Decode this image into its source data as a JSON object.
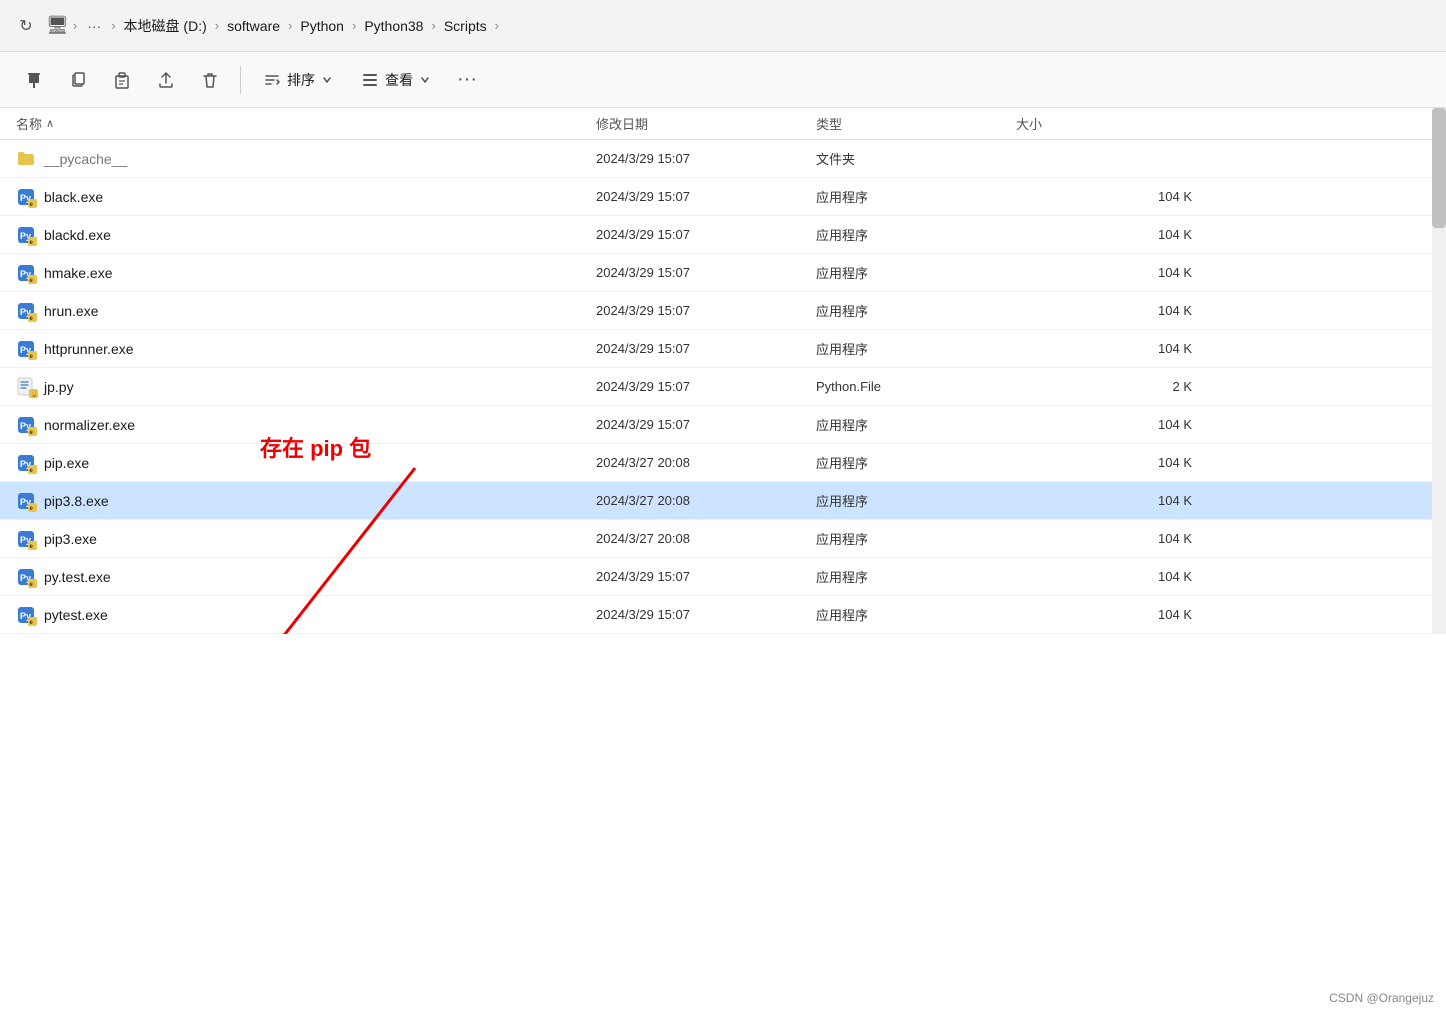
{
  "titlebar": {
    "refresh_icon": "↻",
    "computer_icon": "🖥",
    "breadcrumbs": [
      {
        "label": "本地磁盘 (D:)",
        "id": "local-disk"
      },
      {
        "label": "software",
        "id": "software"
      },
      {
        "label": "Python",
        "id": "python"
      },
      {
        "label": "Python38",
        "id": "python38"
      },
      {
        "label": "Scripts",
        "id": "scripts"
      }
    ],
    "more_label": "···",
    "end_chevron": "›"
  },
  "toolbar": {
    "pin_icon": "📌",
    "copy_icon": "📋",
    "paste_icon": "📄",
    "share_icon": "↑",
    "delete_icon": "🗑",
    "sort_label": "排序",
    "sort_icon": "⇅",
    "view_label": "查看",
    "view_icon": "≡",
    "more_label": "···"
  },
  "columns": {
    "name": "名称",
    "modified": "修改日期",
    "type": "类型",
    "size": "大小",
    "sort_indicator": "∧"
  },
  "annotation": {
    "text": "存在 pip 包",
    "color": "#e00"
  },
  "files": [
    {
      "name": "__pycache__",
      "modified": "2024/3/29 15:07",
      "type": "文件夹",
      "size": "",
      "icon_type": "folder",
      "partial": true
    },
    {
      "name": "black.exe",
      "modified": "2024/3/29 15:07",
      "type": "应用程序",
      "size": "104",
      "icon_type": "exe"
    },
    {
      "name": "blackd.exe",
      "modified": "2024/3/29 15:07",
      "type": "应用程序",
      "size": "104",
      "icon_type": "exe"
    },
    {
      "name": "hmake.exe",
      "modified": "2024/3/29 15:07",
      "type": "应用程序",
      "size": "104",
      "icon_type": "exe"
    },
    {
      "name": "hrun.exe",
      "modified": "2024/3/29 15:07",
      "type": "应用程序",
      "size": "104",
      "icon_type": "exe"
    },
    {
      "name": "httprunner.exe",
      "modified": "2024/3/29 15:07",
      "type": "应用程序",
      "size": "104",
      "icon_type": "exe"
    },
    {
      "name": "jp.py",
      "modified": "2024/3/29 15:07",
      "type": "Python.File",
      "size": "2",
      "icon_type": "py"
    },
    {
      "name": "normalizer.exe",
      "modified": "2024/3/29 15:07",
      "type": "应用程序",
      "size": "104",
      "icon_type": "exe"
    },
    {
      "name": "pip.exe",
      "modified": "2024/3/27 20:08",
      "type": "应用程序",
      "size": "104",
      "icon_type": "exe"
    },
    {
      "name": "pip3.8.exe",
      "modified": "2024/3/27 20:08",
      "type": "应用程序",
      "size": "104",
      "icon_type": "exe",
      "highlighted": true
    },
    {
      "name": "pip3.exe",
      "modified": "2024/3/27 20:08",
      "type": "应用程序",
      "size": "104",
      "icon_type": "exe"
    },
    {
      "name": "py.test.exe",
      "modified": "2024/3/29 15:07",
      "type": "应用程序",
      "size": "104",
      "icon_type": "exe"
    },
    {
      "name": "pytest.exe",
      "modified": "2024/3/29 15:07",
      "type": "应用程序",
      "size": "104",
      "icon_type": "exe"
    }
  ],
  "watermark": "CSDN @Orangejuz"
}
